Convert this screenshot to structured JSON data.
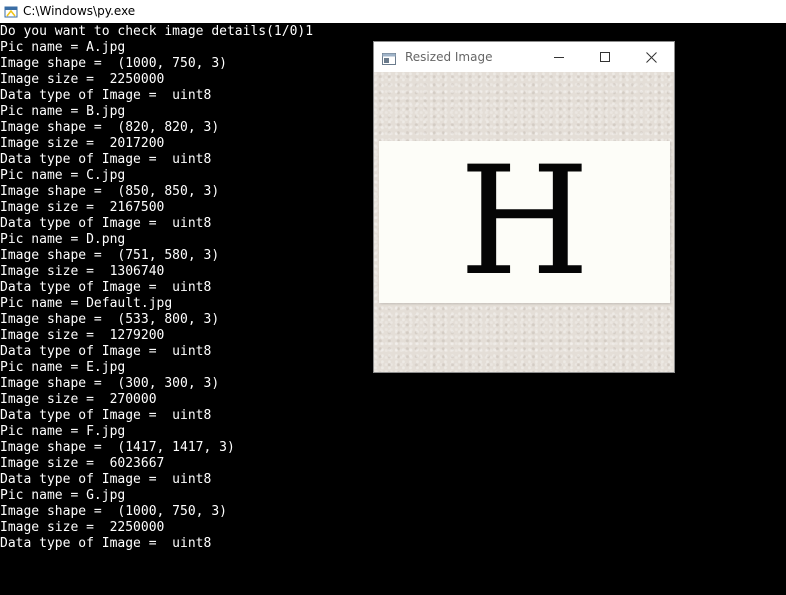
{
  "console": {
    "title": "C:\\Windows\\py.exe",
    "lines": [
      "Do you want to check image details(1/0)1",
      "Pic name = A.jpg",
      "Image shape =  (1000, 750, 3)",
      "Image size =  2250000",
      "Data type of Image =  uint8",
      "Pic name = B.jpg",
      "Image shape =  (820, 820, 3)",
      "Image size =  2017200",
      "Data type of Image =  uint8",
      "Pic name = C.jpg",
      "Image shape =  (850, 850, 3)",
      "Image size =  2167500",
      "Data type of Image =  uint8",
      "Pic name = D.png",
      "Image shape =  (751, 580, 3)",
      "Image size =  1306740",
      "Data type of Image =  uint8",
      "Pic name = Default.jpg",
      "Image shape =  (533, 800, 3)",
      "Image size =  1279200",
      "Data type of Image =  uint8",
      "Pic name = E.jpg",
      "Image shape =  (300, 300, 3)",
      "Image size =  270000",
      "Data type of Image =  uint8",
      "Pic name = F.jpg",
      "Image shape =  (1417, 1417, 3)",
      "Image size =  6023667",
      "Data type of Image =  uint8",
      "Pic name = G.jpg",
      "Image shape =  (1000, 750, 3)",
      "Image size =  2250000",
      "Data type of Image =  uint8"
    ]
  },
  "image_window": {
    "title": "Resized Image",
    "letter": "H",
    "controls": {
      "minimize": "minimize-icon",
      "maximize": "maximize-icon",
      "close": "close-icon"
    }
  },
  "colors": {
    "console_bg": "#000000",
    "console_text": "#ffffff",
    "image_bg": "#e4ded7",
    "image_card": "#fdfdf8"
  }
}
